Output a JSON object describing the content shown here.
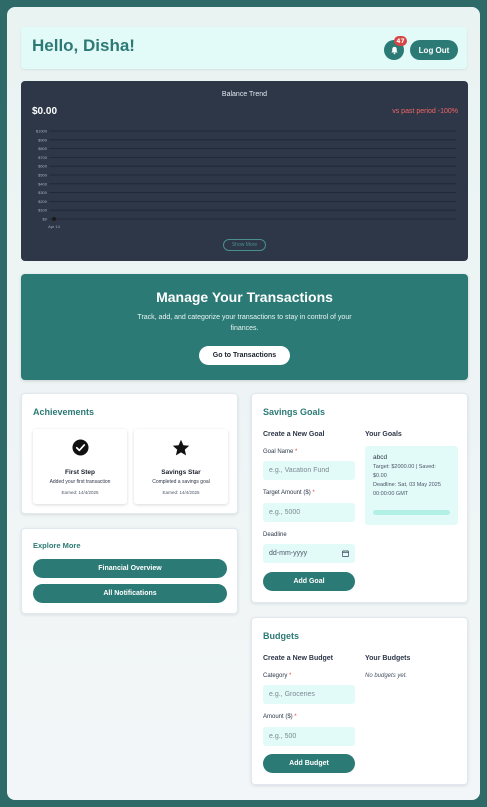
{
  "header": {
    "greeting": "Hello, Disha!",
    "notification_count": "47",
    "logout_label": "Log Out"
  },
  "balance_chart": {
    "title": "Balance Trend",
    "total": "$0.00",
    "change": "vs past period -100%",
    "show_more_label": "Show More"
  },
  "chart_data": {
    "type": "line",
    "title": "Balance Trend",
    "x": [
      "Apr 14"
    ],
    "series": [
      {
        "values": [
          0
        ]
      }
    ],
    "yticks": [
      "$1000",
      "$900",
      "$800",
      "$700",
      "$600",
      "$500",
      "$400",
      "$300",
      "$200",
      "$100",
      "$0"
    ],
    "ylim": [
      0,
      1000
    ],
    "grid": true,
    "colors": {
      "line": "#1a1a1a",
      "grid": "#1f2530",
      "axis_text": "#a0aec0"
    }
  },
  "manage": {
    "title": "Manage Your Transactions",
    "description": "Track, add, and categorize your transactions to stay in control of your finances.",
    "button_label": "Go to Transactions"
  },
  "achievements": {
    "title": "Achievements",
    "items": [
      {
        "icon": "check-circle-icon",
        "name": "First Step",
        "description": "Added your first transaction",
        "earned": "Earned: 14/4/2025"
      },
      {
        "icon": "star-icon",
        "name": "Savings Star",
        "description": "Completed a savings goal",
        "earned": "Earned: 14/4/2025"
      }
    ]
  },
  "explore": {
    "title": "Explore More",
    "buttons": [
      "Financial Overview",
      "All Notifications"
    ]
  },
  "savings": {
    "title": "Savings Goals",
    "create_heading": "Create a New Goal",
    "list_heading": "Your Goals",
    "goal_name_label": "Goal Name",
    "goal_name_placeholder": "e.g., Vacation Fund",
    "target_label": "Target Amount ($)",
    "target_placeholder": "e.g., 5000",
    "deadline_label": "Deadline",
    "deadline_placeholder": "dd-mm-yyyy",
    "add_button": "Add Goal",
    "goals": [
      {
        "name": "abcd",
        "info": "Target: $2000.00 | Saved: $0.00",
        "deadline": "Deadline: Sat, 03 May 2025 00:00:00 GMT",
        "progress": 0
      }
    ]
  },
  "budgets": {
    "title": "Budgets",
    "create_heading": "Create a New Budget",
    "list_heading": "Your Budgets",
    "category_label": "Category",
    "category_placeholder": "e.g., Groceries",
    "amount_label": "Amount ($)",
    "amount_placeholder": "e.g., 500",
    "add_button": "Add Budget",
    "empty_text": "No budgets yet."
  },
  "colors": {
    "accent": "#2c7a75",
    "page_bg": "#2e6b68",
    "chart_bg": "#2d3748",
    "negative": "#f56565",
    "required": "#e53e3e"
  }
}
